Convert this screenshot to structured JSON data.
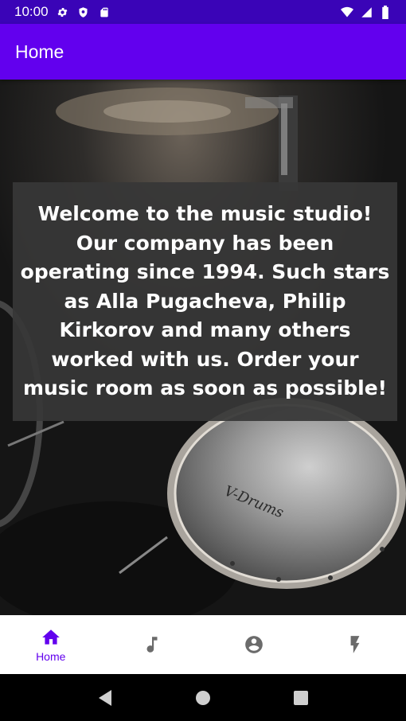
{
  "status_bar": {
    "time": "10:00",
    "left_icons": [
      "gear-icon",
      "shield-icon",
      "sd-card-icon"
    ],
    "right_icons": [
      "wifi-icon",
      "signal-icon",
      "battery-icon"
    ]
  },
  "app_bar": {
    "title": "Home"
  },
  "main": {
    "welcome_text": "Welcome to the music studio! Our company has been operating since 1994. Such stars as Alla Pugacheva, Philip Kirkorov and many others worked with us. Order your music room as soon as possible!",
    "background_image": "drum-kit-photo",
    "drum_brand_text": "V-Drums"
  },
  "bottom_nav": {
    "items": [
      {
        "id": "home",
        "label": "Home",
        "icon": "home-icon",
        "active": true
      },
      {
        "id": "music",
        "label": "",
        "icon": "music-note-icon",
        "active": false
      },
      {
        "id": "account",
        "label": "",
        "icon": "account-circle-icon",
        "active": false
      },
      {
        "id": "flash",
        "label": "",
        "icon": "flash-icon",
        "active": false
      }
    ]
  },
  "colors": {
    "status_bar": "#3a04b7",
    "app_bar": "#6200ee",
    "active_nav": "#6200ee",
    "inactive_nav": "#6b6b6b",
    "welcome_box": "#373737"
  },
  "system_nav": {
    "buttons": [
      "back-icon",
      "home-circle-icon",
      "recents-icon"
    ]
  }
}
